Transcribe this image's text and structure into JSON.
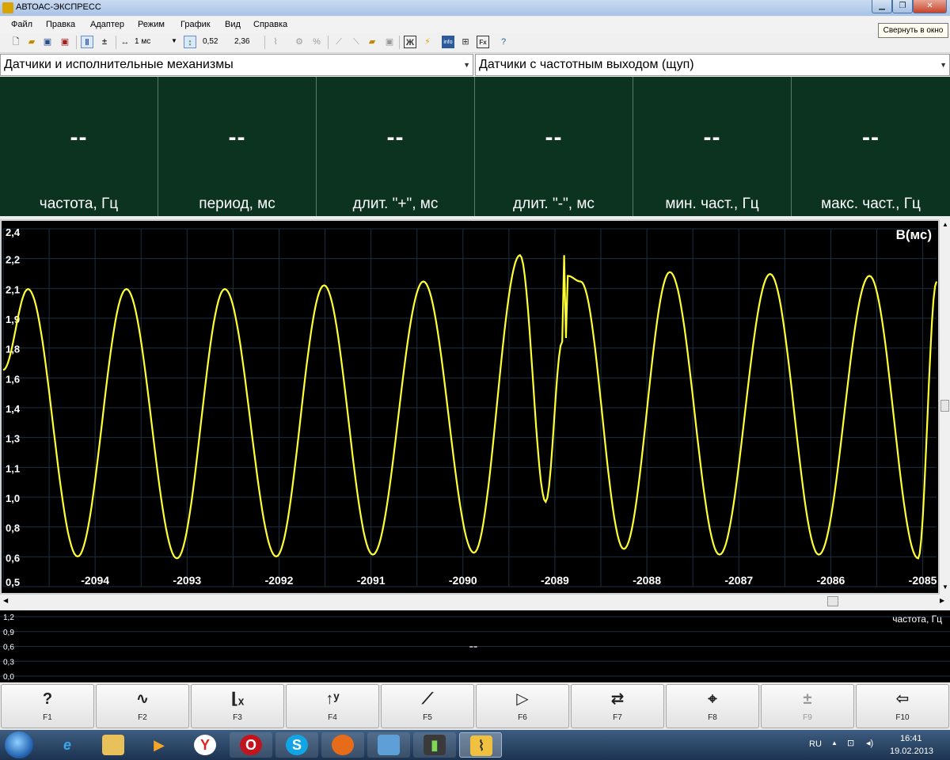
{
  "window": {
    "title": "АВТОАС-ЭКСПРЕСС",
    "tooltip": "Свернуть в окно"
  },
  "menu": [
    "Файл",
    "Правка",
    "Адаптер",
    "Режим",
    "График",
    "Вид",
    "Справка"
  ],
  "toolbar": {
    "timebase": "1 мс",
    "cursor_a": "0,52",
    "cursor_b": "2,36"
  },
  "selectors": {
    "left": "Датчики и исполнительные механизмы",
    "right": "Датчики с частотным выходом (щуп)"
  },
  "meters": [
    {
      "value": "--",
      "label": "частота, Гц"
    },
    {
      "value": "--",
      "label": "период, мс"
    },
    {
      "value": "--",
      "label": "длит. \"+\", мс"
    },
    {
      "value": "--",
      "label": "длит. \"-\", мс"
    },
    {
      "value": "--",
      "label": "мин. част., Гц"
    },
    {
      "value": "--",
      "label": "макс. част., Гц"
    }
  ],
  "chart_data": [
    {
      "type": "line",
      "title": "В(мс)",
      "ylim": [
        0.5,
        2.4
      ],
      "yticks": [
        "2,4",
        "2,2",
        "2,1",
        "1,9",
        "1,8",
        "1,6",
        "1,4",
        "1,3",
        "1,1",
        "1,0",
        "0,8",
        "0,6",
        "0,5"
      ],
      "xlim": [
        -2095.0,
        -2084.85
      ],
      "xticks": [
        "-2094",
        "-2093",
        "-2092",
        "-2091",
        "-2090",
        "-2089",
        "-2088",
        "-2087",
        "-2086",
        "-2085"
      ],
      "grid": true,
      "colors": {
        "signal": "#ffff33",
        "grid": "#1d2f3f",
        "axis_text": "#ffffff"
      },
      "series": [
        {
          "x": [
            -2095.0,
            -2094.73,
            -2094.19,
            -2093.66,
            -2093.11,
            -2092.59,
            -2092.03,
            -2091.51,
            -2090.98,
            -2090.43,
            -2089.88,
            -2089.38,
            -2089.1,
            -2088.92,
            -2088.9,
            -2088.88,
            -2088.86,
            -2088.72,
            -2088.25,
            -2087.75,
            -2087.21,
            -2086.66,
            -2086.13,
            -2085.58,
            -2085.05,
            -2084.85
          ],
          "y": [
            1.65,
            2.08,
            0.66,
            2.08,
            0.65,
            2.08,
            0.66,
            2.1,
            0.67,
            2.12,
            0.68,
            2.26,
            0.95,
            1.8,
            2.26,
            1.82,
            2.15,
            2.12,
            0.7,
            2.17,
            0.67,
            2.16,
            0.67,
            2.15,
            0.65,
            2.12
          ]
        }
      ]
    },
    {
      "type": "line",
      "title": "частота, Гц",
      "ylim": [
        0.0,
        1.2
      ],
      "yticks": [
        "1,2",
        "0,9",
        "0,6",
        "0,3",
        "0,0"
      ],
      "marker": "--",
      "series": []
    }
  ],
  "fkeys": [
    {
      "key": "F1",
      "icon": "question-icon"
    },
    {
      "key": "F2",
      "icon": "wave-icon"
    },
    {
      "key": "F3",
      "icon": "x-axis-icon"
    },
    {
      "key": "F4",
      "icon": "y-axis-icon"
    },
    {
      "key": "F5",
      "icon": "probe-icon"
    },
    {
      "key": "F6",
      "icon": "play-icon"
    },
    {
      "key": "F7",
      "icon": "swap-arrows-icon"
    },
    {
      "key": "F8",
      "icon": "crosshair-icon"
    },
    {
      "key": "F9",
      "icon": "plus-minus-icon"
    },
    {
      "key": "F10",
      "icon": "exit-icon"
    }
  ],
  "taskbar": {
    "lang": "RU",
    "time": "16:41",
    "date": "19.02.2013"
  }
}
